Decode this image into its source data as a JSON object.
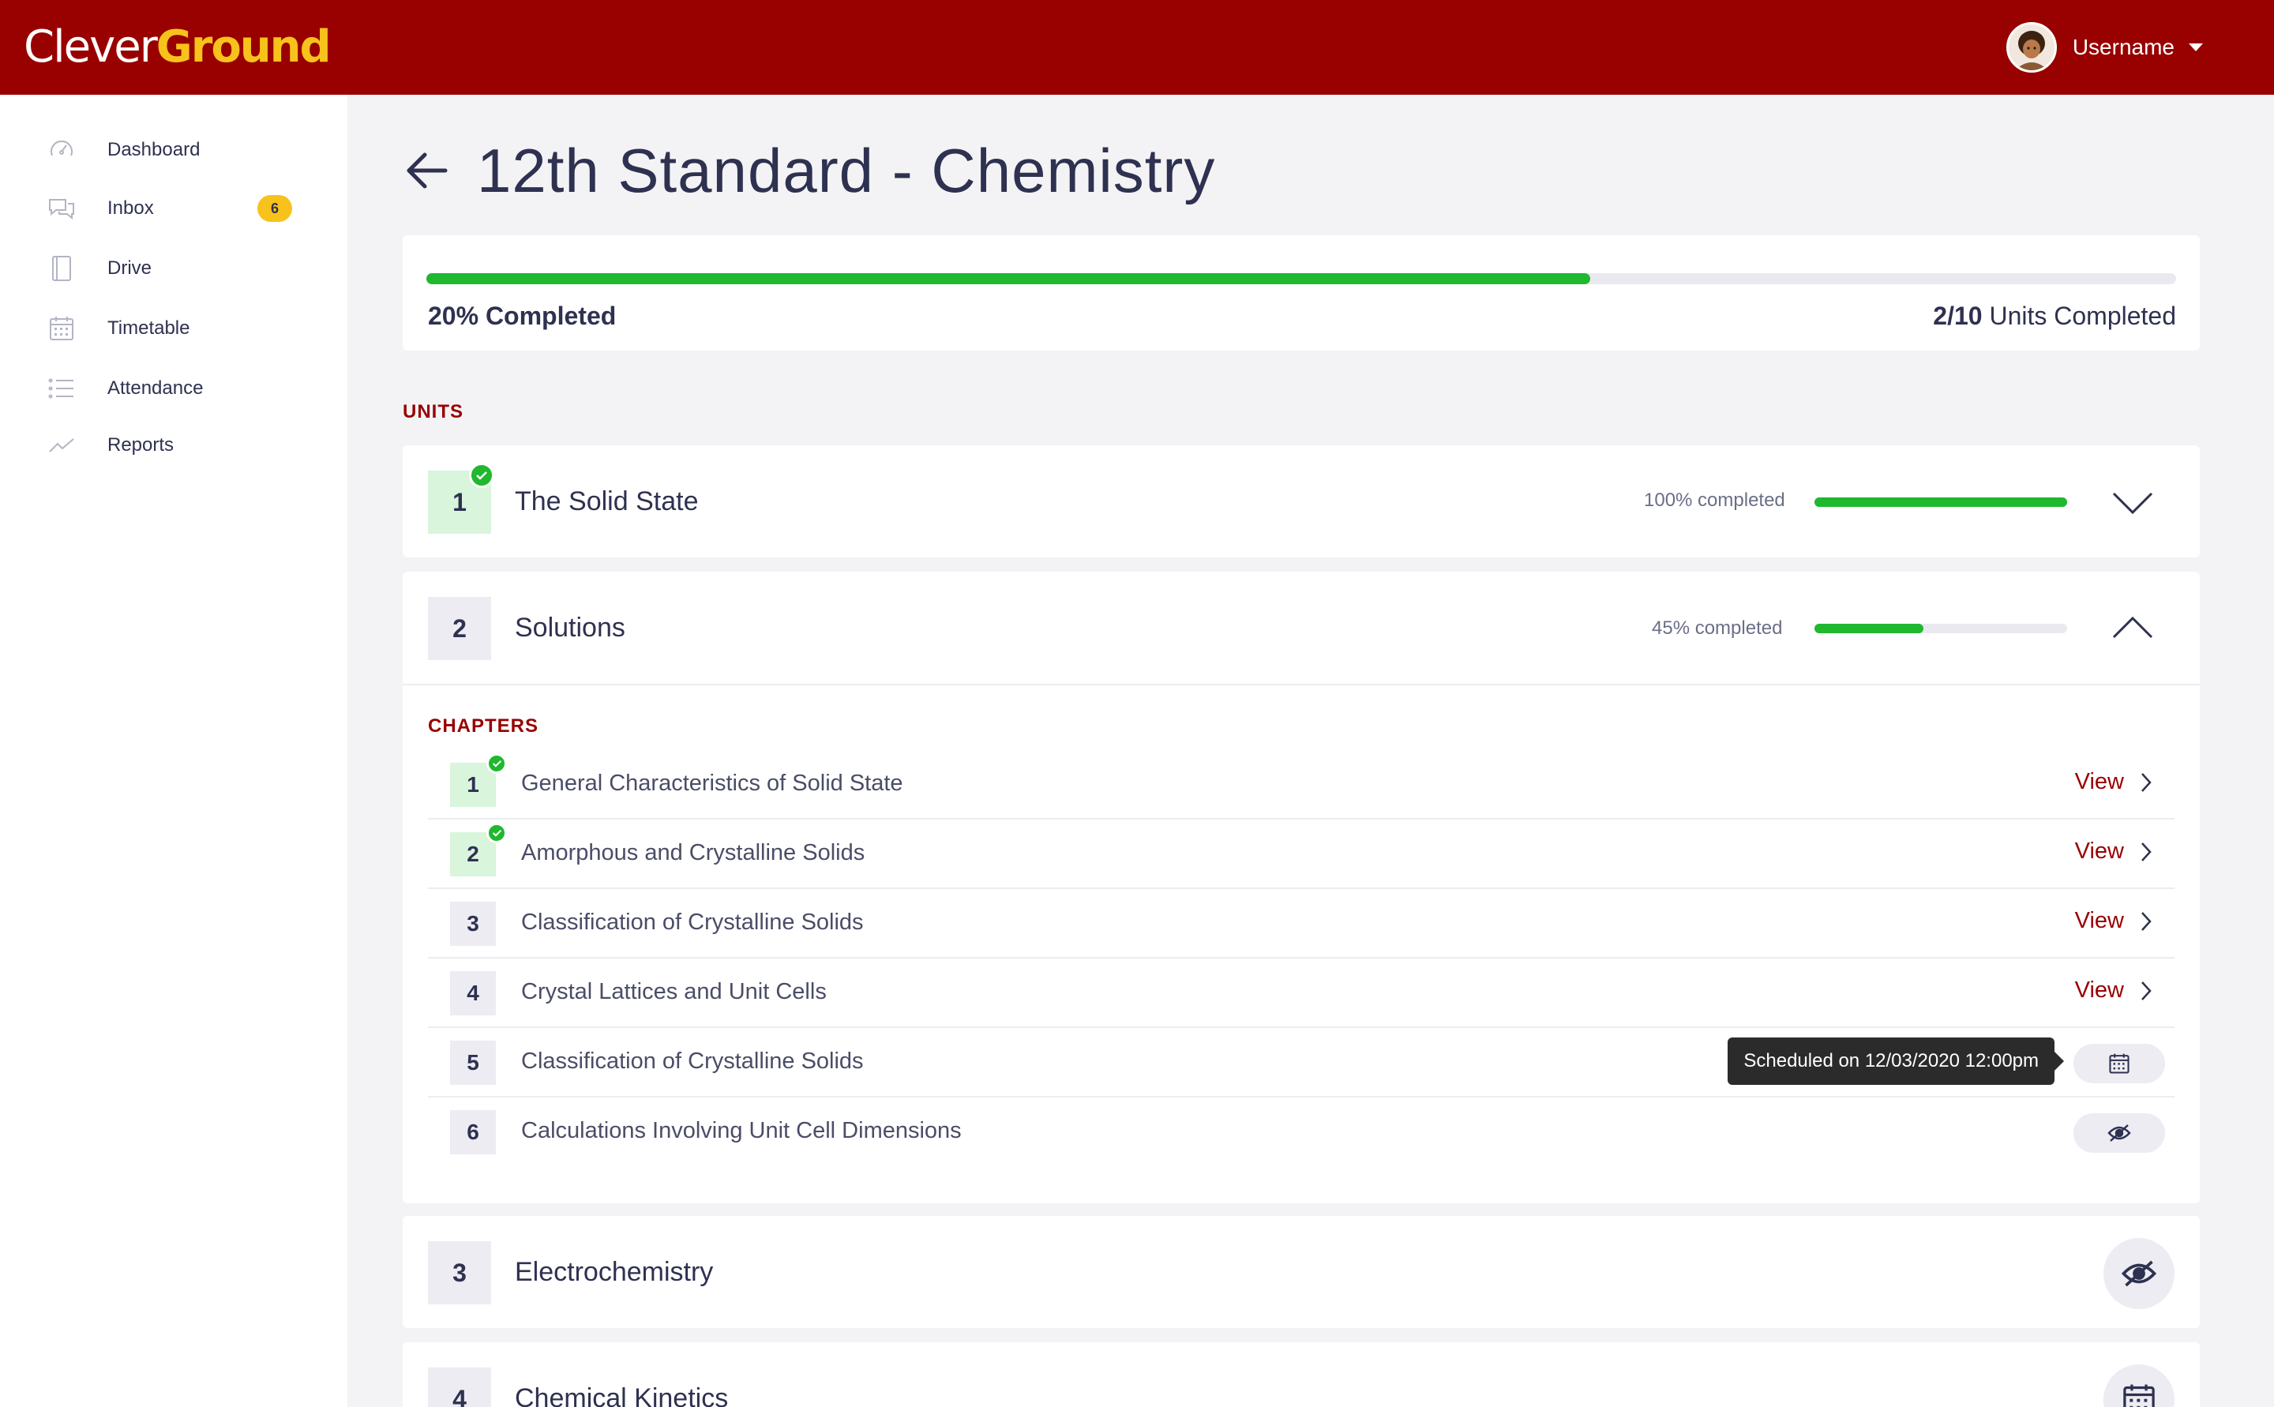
{
  "brand": {
    "name_part1": "Clever",
    "name_part2": "Ground",
    "primary_color": "#990000",
    "accent_color": "#f7c21c"
  },
  "user": {
    "name": "Username",
    "avatar_icon": "user-avatar"
  },
  "sidebar": {
    "items": [
      {
        "label": "Dashboard",
        "icon": "speedometer-icon"
      },
      {
        "label": "Inbox",
        "icon": "chat-bubbles-icon",
        "badge": "6"
      },
      {
        "label": "Drive",
        "icon": "notebook-icon"
      },
      {
        "label": "Timetable",
        "icon": "calendar-icon"
      },
      {
        "label": "Attendance",
        "icon": "list-icon"
      },
      {
        "label": "Reports",
        "icon": "trend-line-icon"
      }
    ]
  },
  "page": {
    "title": "12th Standard - Chemistry",
    "back_icon": "arrow-left-icon"
  },
  "progress": {
    "percent": 0.665,
    "completed_label": "20% Completed",
    "units_done": "2/10",
    "units_suffix": " Units Completed",
    "fill_color": "#1fb82e"
  },
  "units_heading": "UNITS",
  "chapters_heading": "CHAPTERS",
  "units": [
    {
      "number": "1",
      "title": "The Solid State",
      "status": "completed",
      "percent_label": "100% completed",
      "percent": 1.0,
      "toggle_icon": "chevron-down-icon"
    },
    {
      "number": "2",
      "title": "Solutions",
      "status": "in-progress",
      "percent_label": "45% completed",
      "percent": 0.43,
      "toggle_icon": "chevron-up-icon",
      "chapters": [
        {
          "number": "1",
          "title": "General Characteristics of Solid State",
          "done": true,
          "action": "View"
        },
        {
          "number": "2",
          "title": "Amorphous and Crystalline Solids",
          "done": true,
          "action": "View"
        },
        {
          "number": "3",
          "title": "Classification of Crystalline Solids",
          "done": false,
          "action": "View"
        },
        {
          "number": "4",
          "title": "Crystal Lattices and Unit Cells",
          "done": false,
          "action": "View"
        },
        {
          "number": "5",
          "title": "Classification of Crystalline Solids",
          "done": false,
          "state": "scheduled",
          "tooltip": "Scheduled on 12/03/2020 12:00pm",
          "icon": "calendar-icon"
        },
        {
          "number": "6",
          "title": "Calculations Involving Unit Cell Dimensions",
          "done": false,
          "state": "hidden",
          "icon": "eye-off-icon"
        }
      ]
    },
    {
      "number": "3",
      "title": "Electrochemistry",
      "status": "hidden",
      "icon": "eye-off-icon"
    },
    {
      "number": "4",
      "title": "Chemical Kinetics",
      "status": "scheduled",
      "icon": "calendar-icon"
    }
  ]
}
